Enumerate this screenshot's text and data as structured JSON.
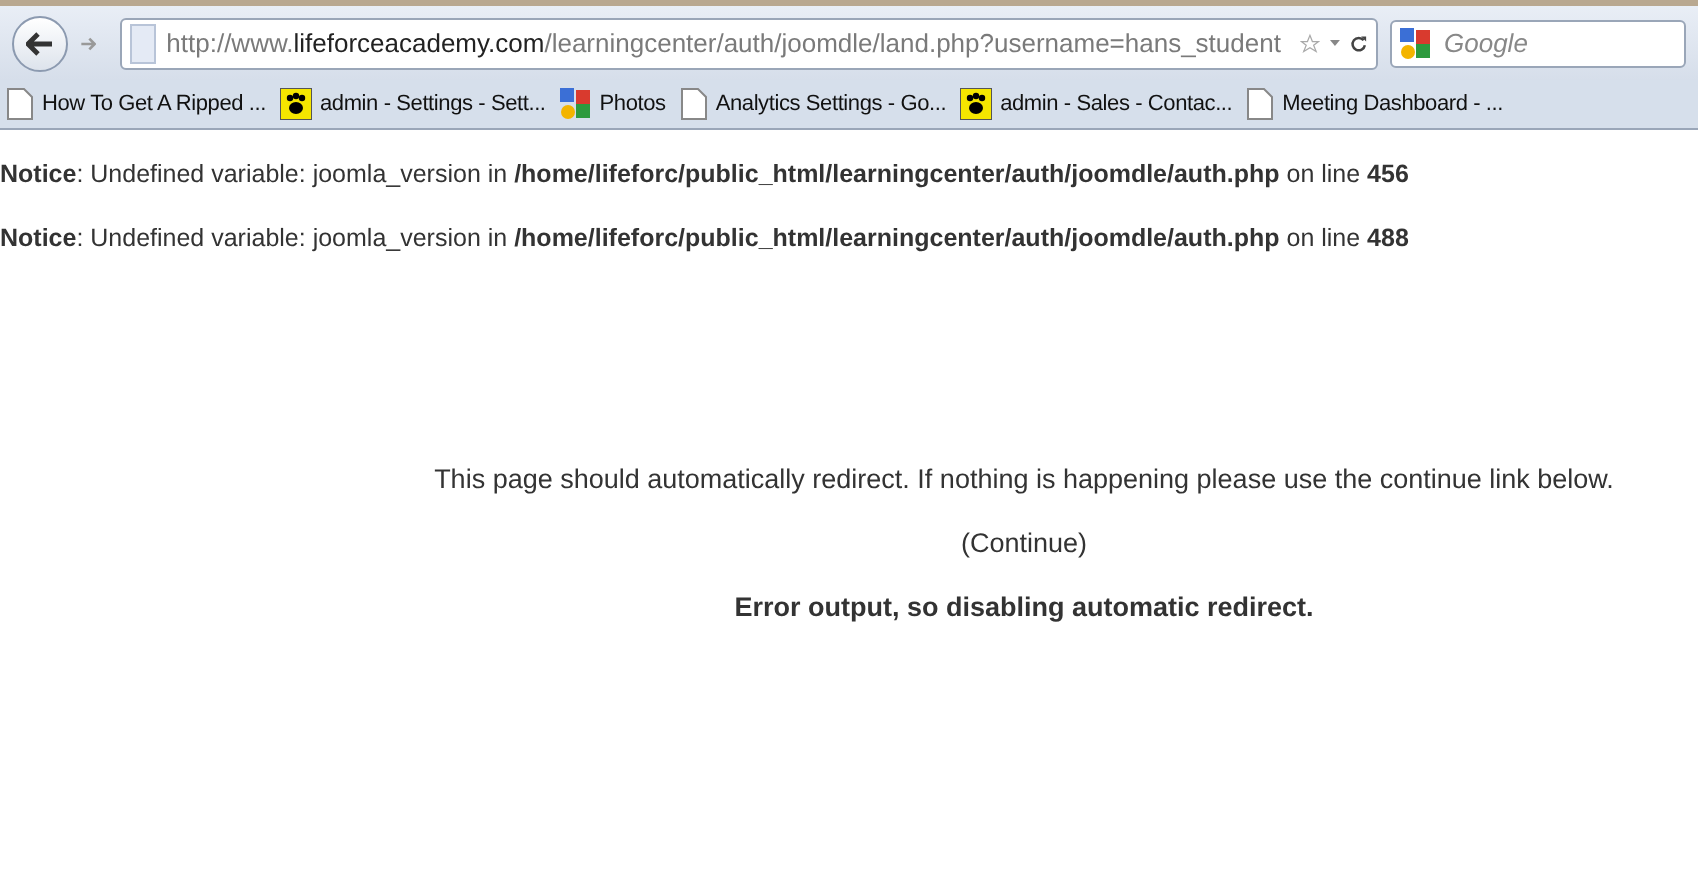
{
  "toolbar": {
    "url": {
      "scheme": "http://www.",
      "host": "lifeforceacademy.com",
      "path": "/learningcenter/auth/joomdle/land.php?username=hans_student"
    },
    "search": {
      "placeholder": "Google"
    }
  },
  "bookmarks": [
    {
      "label": "How To Get A Ripped ...",
      "kind": "page"
    },
    {
      "label": "admin - Settings - Sett...",
      "kind": "paw"
    },
    {
      "label": "Photos",
      "kind": "google"
    },
    {
      "label": "Analytics Settings - Go...",
      "kind": "page"
    },
    {
      "label": "admin - Sales - Contac...",
      "kind": "paw"
    },
    {
      "label": "Meeting Dashboard - ...",
      "kind": "page"
    }
  ],
  "notices": [
    "**Notice**: Undefined variable: joomla_version in **/home/lifeforc/public_html/learningcenter/auth/joomdle/auth.php** on line **456**",
    "**Notice**: Undefined variable: joomla_version in **/home/lifeforc/public_html/learningcenter/auth/joomdle/auth.php** on line **488**"
  ],
  "redirect": {
    "message": "This page should automatically redirect. If nothing is happening please use the continue link below.",
    "link": "(Continue)",
    "error": "Error output, so disabling automatic redirect."
  }
}
